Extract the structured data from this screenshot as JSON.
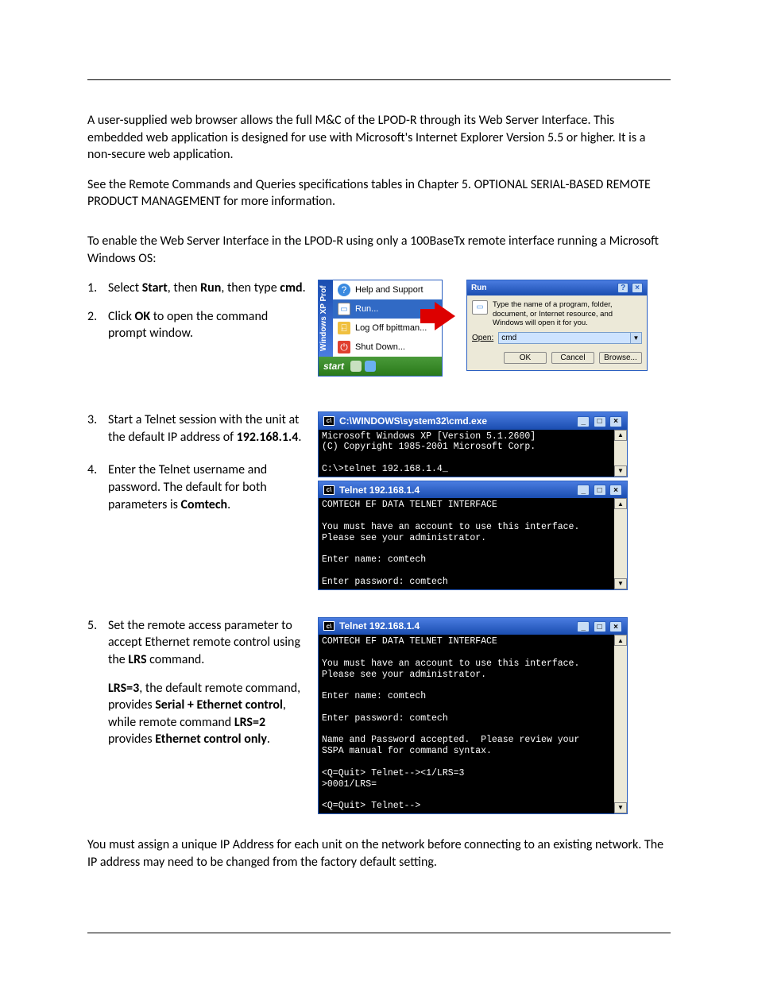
{
  "para1": "A user-supplied web browser allows the full M&C of the LPOD-R through its Web Server Interface. This embedded web application is designed for use with Microsoft's Internet Explorer Version 5.5 or higher. It is a non-secure web application.",
  "para2": "See the Remote Commands and Queries specifications tables in Chapter 5. OPTIONAL SERIAL-BASED REMOTE PRODUCT MANAGEMENT for more information.",
  "para3": "To enable the Web Server Interface in the LPOD-R using only a 100BaseTx remote interface running a Microsoft Windows OS:",
  "steps": {
    "s1a": "Select ",
    "s1b": "Start",
    "s1c": ", then ",
    "s1d": "Run",
    "s1e": ", then type ",
    "s1f": "cmd",
    "s1g": ".",
    "s2a": "Click ",
    "s2b": "OK",
    "s2c": " to open the command prompt window.",
    "s3a": "Start a Telnet session with the unit at the default IP address of ",
    "s3b": "192.168.1.4",
    "s3c": ".",
    "s4a": "Enter the Telnet username and password. The default for both parameters is ",
    "s4b": "Comtech",
    "s4c": ".",
    "s5a": "Set the remote access parameter to accept Ethernet remote control using the ",
    "s5b": "LRS",
    "s5c": " command.",
    "s5d": "LRS=3",
    "s5e": ", the default remote command, provides ",
    "s5f": "Serial + Ethernet control",
    "s5g": ", while remote command ",
    "s5h": "LRS=2",
    "s5i": " provides ",
    "s5j": "Ethernet control only",
    "s5k": "."
  },
  "startmenu": {
    "side": "Windows XP  Prof",
    "items": [
      "Help and Support",
      "Run...",
      "Log Off bpittman...",
      "Shut Down..."
    ],
    "start": "start"
  },
  "run": {
    "title": "Run",
    "desc": "Type the name of a program, folder, document, or Internet resource, and Windows will open it for you.",
    "open_label": "Open:",
    "open_value": "cmd",
    "ok": "OK",
    "cancel": "Cancel",
    "browse": "Browse..."
  },
  "cmd1": {
    "title": "C:\\WINDOWS\\system32\\cmd.exe",
    "text": "Microsoft Windows XP [Version 5.1.2600]\n(C) Copyright 1985-2001 Microsoft Corp.\n\nC:\\>telnet 192.168.1.4_"
  },
  "cmd2": {
    "title": "Telnet 192.168.1.4",
    "text": "COMTECH EF DATA TELNET INTERFACE\n\nYou must have an account to use this interface.\nPlease see your administrator.\n\nEnter name: comtech\n\nEnter password: comtech\n"
  },
  "cmd3": {
    "title": "Telnet 192.168.1.4",
    "text": "COMTECH EF DATA TELNET INTERFACE\n\nYou must have an account to use this interface.\nPlease see your administrator.\n\nEnter name: comtech\n\nEnter password: comtech\n\nName and Password accepted.  Please review your\nSSPA manual for command syntax.\n\n<Q=Quit> Telnet--><1/LRS=3\n>0001/LRS=\n\n<Q=Quit> Telnet-->"
  },
  "para4": "You must assign a unique IP Address for each unit on the network before connecting to an existing network. The IP address may need to be changed from the factory default setting."
}
